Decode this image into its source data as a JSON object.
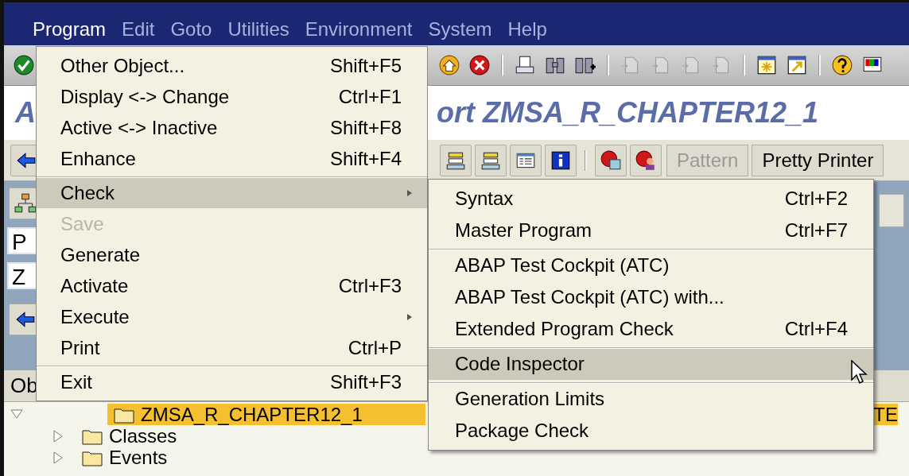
{
  "menubar": [
    {
      "label": "Program",
      "selected": true
    },
    {
      "label": "Edit",
      "selected": false
    },
    {
      "label": "Goto",
      "selected": false
    },
    {
      "label": "Utilities",
      "selected": false
    },
    {
      "label": "Environment",
      "selected": false
    },
    {
      "label": "System",
      "selected": false
    },
    {
      "label": "Help",
      "selected": false
    }
  ],
  "toolbar": {
    "left": [
      {
        "kind": "enter",
        "disabled": false
      }
    ],
    "right": [
      {
        "kind": "up",
        "disabled": false
      },
      {
        "kind": "cancel",
        "disabled": false
      },
      {
        "kind": "sep"
      },
      {
        "kind": "print",
        "disabled": false
      },
      {
        "kind": "find",
        "disabled": false
      },
      {
        "kind": "find-next",
        "disabled": false
      },
      {
        "kind": "sep"
      },
      {
        "kind": "page",
        "disabled": true
      },
      {
        "kind": "page",
        "disabled": true
      },
      {
        "kind": "page",
        "disabled": true
      },
      {
        "kind": "page",
        "disabled": true
      },
      {
        "kind": "sep"
      },
      {
        "kind": "new-window",
        "disabled": false
      },
      {
        "kind": "shortcut",
        "disabled": false
      },
      {
        "kind": "sep"
      },
      {
        "kind": "help",
        "disabled": false
      },
      {
        "kind": "layout",
        "disabled": false
      }
    ]
  },
  "title": {
    "visible_start": "A",
    "visible_end": "ort ZMSA_R_CHAPTER12_1"
  },
  "app_toolbar": {
    "left": [
      {
        "kind": "back"
      }
    ],
    "right": [
      {
        "kind": "stack"
      },
      {
        "kind": "stack"
      },
      {
        "kind": "list"
      },
      {
        "kind": "info"
      },
      {
        "kind": "sep"
      },
      {
        "kind": "stop-window"
      },
      {
        "kind": "stop-person"
      }
    ],
    "buttons": [
      {
        "label": "Pattern",
        "disabled": true
      },
      {
        "label": "Pretty Printer",
        "disabled": false
      }
    ]
  },
  "left_panel": {
    "fields": [
      "P",
      "Z"
    ],
    "column_header": "Ob"
  },
  "tree": {
    "root": {
      "label": "ZMSA_R_CHAPTER12_1",
      "expanded": true,
      "selected": true,
      "right_text": "TE"
    },
    "children": [
      {
        "label": "Classes",
        "expanded": false
      },
      {
        "label": "Events",
        "expanded": false
      }
    ]
  },
  "menu": [
    {
      "label": "Other Object...",
      "shortcut": "Shift+F5",
      "selected": false,
      "disabled": false,
      "submenu": false,
      "separator_before": false
    },
    {
      "label": "Display <-> Change",
      "shortcut": "Ctrl+F1",
      "selected": false,
      "disabled": false,
      "submenu": false,
      "separator_before": false
    },
    {
      "label": "Active <-> Inactive",
      "shortcut": "Shift+F8",
      "selected": false,
      "disabled": false,
      "submenu": false,
      "separator_before": false
    },
    {
      "label": "Enhance",
      "shortcut": "Shift+F4",
      "selected": false,
      "disabled": false,
      "submenu": false,
      "separator_before": false
    },
    {
      "label": "Check",
      "selected": true,
      "disabled": false,
      "submenu": true,
      "separator_before": true
    },
    {
      "label": "Save",
      "selected": false,
      "disabled": true,
      "submenu": false,
      "separator_before": false
    },
    {
      "label": "Generate",
      "selected": false,
      "disabled": false,
      "submenu": false,
      "separator_before": false
    },
    {
      "label": "Activate",
      "shortcut": "Ctrl+F3",
      "selected": false,
      "disabled": false,
      "submenu": false,
      "separator_before": false
    },
    {
      "label": "Execute",
      "selected": false,
      "disabled": false,
      "submenu": true,
      "separator_before": false
    },
    {
      "label": "Print",
      "shortcut": "Ctrl+P",
      "selected": false,
      "disabled": false,
      "submenu": false,
      "separator_before": false
    },
    {
      "label": "Exit",
      "shortcut": "Shift+F3",
      "selected": false,
      "disabled": false,
      "submenu": false,
      "separator_before": true
    }
  ],
  "submenu": [
    {
      "label": "Syntax",
      "shortcut": "Ctrl+F2",
      "selected": false,
      "separator_before": false
    },
    {
      "label": "Master Program",
      "shortcut": "Ctrl+F7",
      "selected": false,
      "separator_before": false
    },
    {
      "label": "ABAP Test Cockpit (ATC)",
      "selected": false,
      "separator_before": true
    },
    {
      "label": "ABAP Test Cockpit (ATC) with...",
      "selected": false,
      "separator_before": false
    },
    {
      "label": "Extended Program Check",
      "shortcut": "Ctrl+F4",
      "selected": false,
      "separator_before": false
    },
    {
      "label": "Code Inspector",
      "selected": true,
      "separator_before": true
    },
    {
      "label": "Generation Limits",
      "selected": false,
      "separator_before": true
    },
    {
      "label": "Package Check",
      "selected": false,
      "separator_before": false
    }
  ]
}
